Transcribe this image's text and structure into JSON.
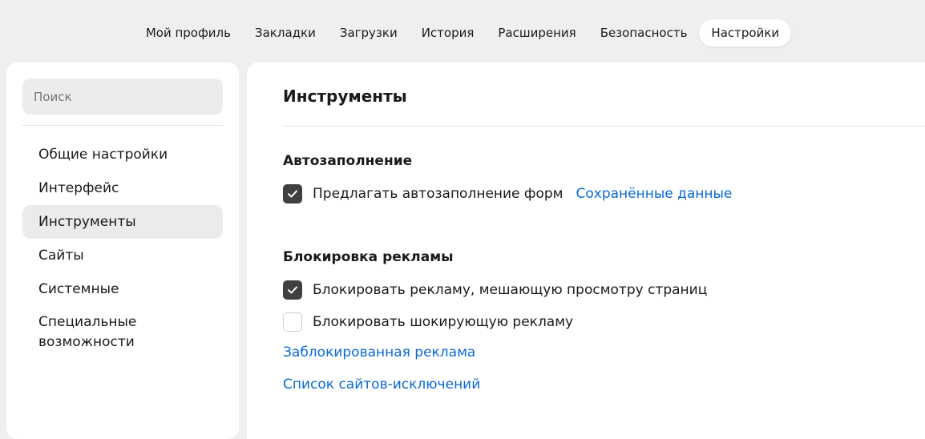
{
  "topnav": {
    "tabs": [
      {
        "label": "Мой профиль",
        "active": false
      },
      {
        "label": "Закладки",
        "active": false
      },
      {
        "label": "Загрузки",
        "active": false
      },
      {
        "label": "История",
        "active": false
      },
      {
        "label": "Расширения",
        "active": false
      },
      {
        "label": "Безопасность",
        "active": false
      },
      {
        "label": "Настройки",
        "active": true
      }
    ]
  },
  "sidebar": {
    "search_placeholder": "Поиск",
    "items": [
      {
        "label": "Общие настройки",
        "active": false
      },
      {
        "label": "Интерфейс",
        "active": false
      },
      {
        "label": "Инструменты",
        "active": true
      },
      {
        "label": "Сайты",
        "active": false
      },
      {
        "label": "Системные",
        "active": false
      },
      {
        "label": "Специальные возможности",
        "active": false
      }
    ]
  },
  "main": {
    "title": "Инструменты",
    "autofill": {
      "heading": "Автозаполнение",
      "option_label": "Предлагать автозаполнение форм",
      "option_checked": true,
      "saved_data_link": "Сохранённые данные"
    },
    "adblock": {
      "heading": "Блокировка рекламы",
      "options": [
        {
          "label": "Блокировать рекламу, мешающую просмотру страниц",
          "checked": true
        },
        {
          "label": "Блокировать шокирующую рекламу",
          "checked": false
        }
      ],
      "blocked_ads_link": "Заблокированная реклама",
      "exceptions_link": "Список сайтов-исключений"
    }
  },
  "colors": {
    "page_bg": "#f0efed",
    "panel_bg": "#ffffff",
    "link": "#0a69d6",
    "checkbox_checked": "#404040",
    "active_item_bg": "#ebebeb"
  }
}
